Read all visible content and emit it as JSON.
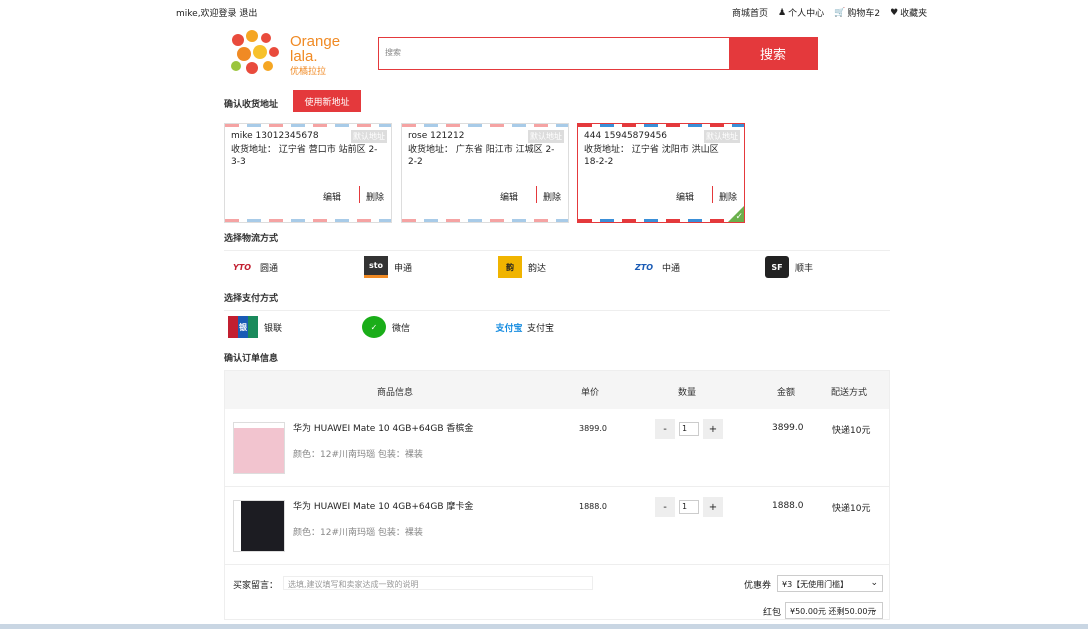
{
  "topbar": {
    "greeting": "mike,欢迎登录 退出",
    "mall_home": "商城首页",
    "user_center": "个人中心",
    "cart": "购物车2",
    "favorites": "收藏夹"
  },
  "logo": {
    "word1": "Orange",
    "word2": "lala.",
    "cn": "优橘拉拉"
  },
  "search": {
    "placeholder": "搜索",
    "button": "搜索"
  },
  "address_section": {
    "title": "确认收货地址",
    "new_button": "使用新地址",
    "cards": [
      {
        "name": "mike 13012345678",
        "default": "默认地址",
        "address": "收货地址： 辽宁省 营口市 站前区 2-3-3",
        "edit": "编辑",
        "delete": "删除",
        "selected": false
      },
      {
        "name": "rose 121212",
        "default": "默认地址",
        "address": "收货地址： 广东省 阳江市 江城区 2-2-2",
        "edit": "编辑",
        "delete": "删除",
        "selected": false
      },
      {
        "name": "444 15945879456",
        "default": "默认地址",
        "address": "收货地址： 辽宁省 沈阳市 洪山区 18-2-2",
        "edit": "编辑",
        "delete": "删除",
        "selected": true
      }
    ]
  },
  "logistics": {
    "title": "选择物流方式",
    "options": [
      {
        "icon": "yto",
        "label": "圆通",
        "color": "#c21f30"
      },
      {
        "icon": "sto",
        "label": "申通",
        "color": "#333333"
      },
      {
        "icon": "yunda",
        "label": "韵达",
        "color": "#f0b400"
      },
      {
        "icon": "zto",
        "label": "中通",
        "color": "#1a5bb5"
      },
      {
        "icon": "sf",
        "label": "顺丰",
        "color": "#222222"
      }
    ]
  },
  "payment": {
    "title": "选择支付方式",
    "options": [
      {
        "icon": "unionpay",
        "label": "银联"
      },
      {
        "icon": "wechat",
        "label": "微信"
      },
      {
        "icon": "alipay",
        "label": "支付宝"
      }
    ]
  },
  "order": {
    "title": "确认订单信息",
    "headers": {
      "product": "商品信息",
      "price": "单价",
      "qty": "数量",
      "total": "金额",
      "shipping": "配送方式"
    },
    "items": [
      {
        "name": "华为 HUAWEI Mate 10 4GB+64GB 香槟金",
        "attr": "颜色：12#川南玛瑙 包装：裸装",
        "price": "3899.0",
        "qty": "1",
        "total": "3899.0",
        "shipping": "快递10元",
        "img_color": "#f2c4cf"
      },
      {
        "name": "华为 HUAWEI Mate 10 4GB+64GB 摩卡金",
        "attr": "颜色：12#川南玛瑙 包装：裸装",
        "price": "1888.0",
        "qty": "1",
        "total": "1888.0",
        "shipping": "快递10元",
        "img_color": "#1c1c22"
      }
    ],
    "minus": "-",
    "plus": "+",
    "message_label": "买家留言：",
    "message_placeholder": "选填,建议填写和卖家达成一致的说明",
    "coupon_label": "优惠券",
    "coupon_value": "¥3【无使用门槛】",
    "redpacket_label": "红包",
    "redpacket_value": "¥50.00元 还剩50.00元"
  }
}
